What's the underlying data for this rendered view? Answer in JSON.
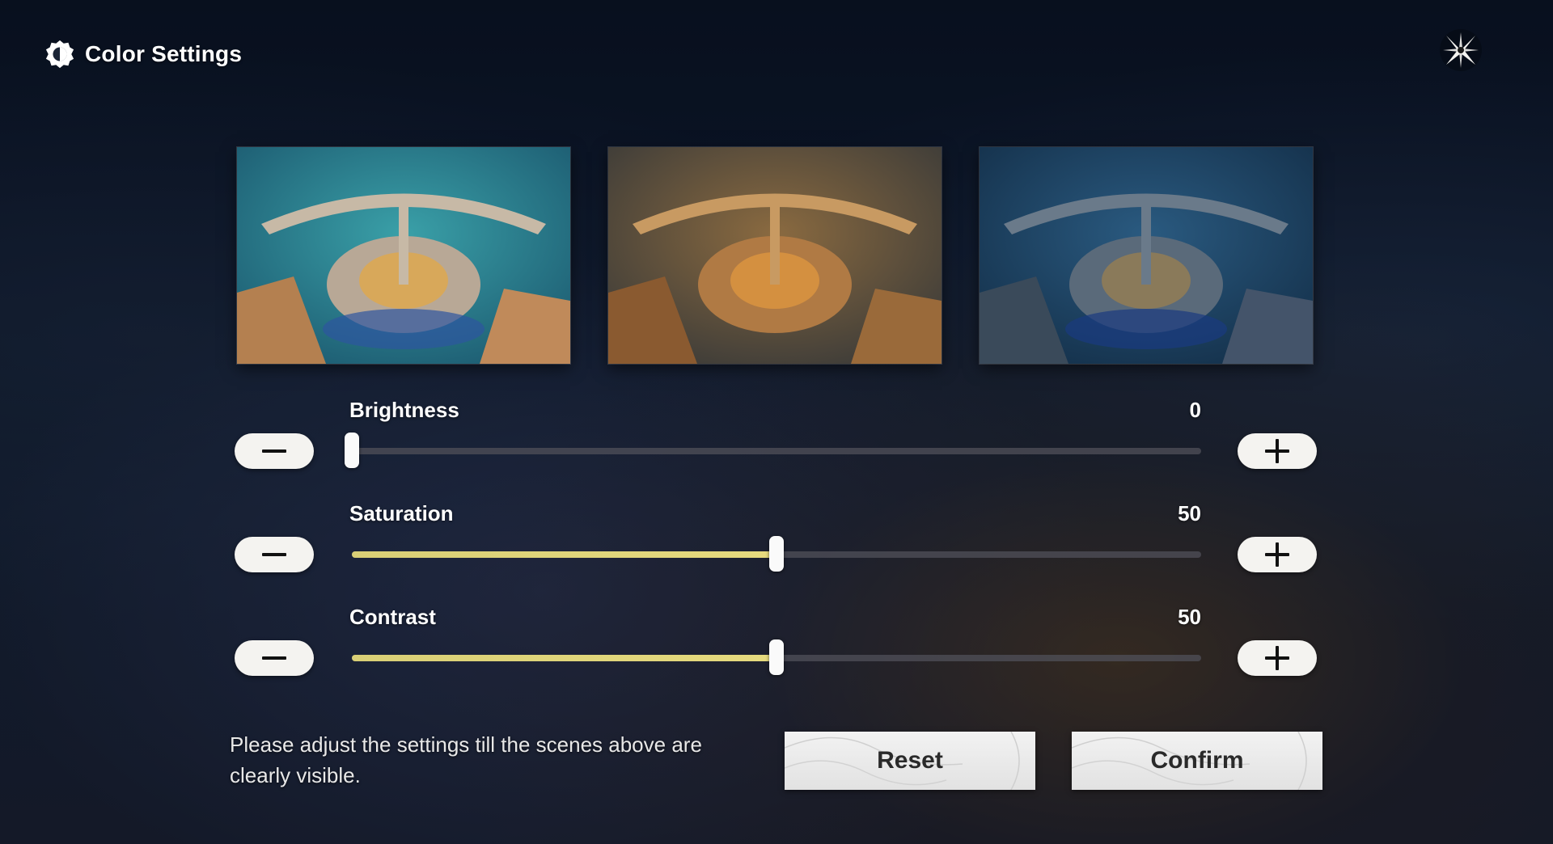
{
  "header": {
    "title": "Color Settings",
    "icon": "sun-gear-icon"
  },
  "close": {
    "icon": "close-star-icon"
  },
  "previews": [
    {
      "name": "preview-normal",
      "tint": "#2a7a8a"
    },
    {
      "name": "preview-warm",
      "tint": "#8a5a30"
    },
    {
      "name": "preview-dark",
      "tint": "#1e4060"
    }
  ],
  "sliders": {
    "brightness": {
      "label": "Brightness",
      "value": "0",
      "level": 0
    },
    "saturation": {
      "label": "Saturation",
      "value": "50",
      "level": 0.5
    },
    "contrast": {
      "label": "Contrast",
      "value": "50",
      "level": 0.5
    }
  },
  "hint": "Please adjust the settings till the scenes above are clearly visible.",
  "buttons": {
    "reset": "Reset",
    "confirm": "Confirm"
  },
  "colors": {
    "accent": "#e3d77b",
    "button_bg": "#f4f3f0"
  }
}
